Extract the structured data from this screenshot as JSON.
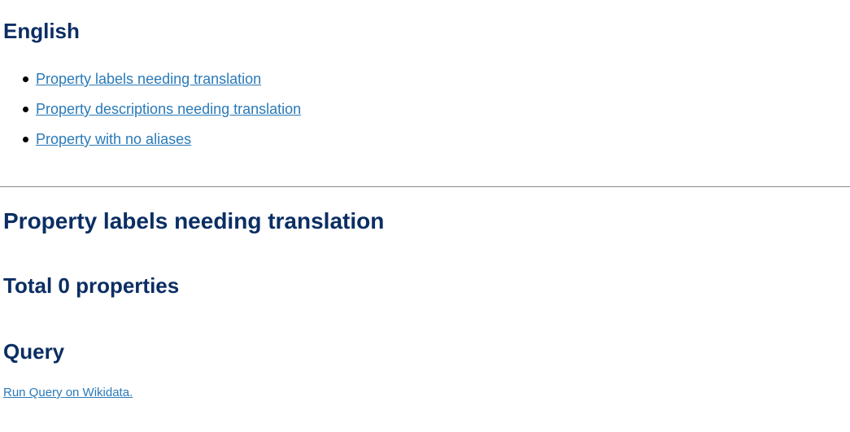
{
  "language_section": {
    "heading": "English",
    "links": [
      {
        "label": "Property labels needing translation"
      },
      {
        "label": "Property descriptions needing translation"
      },
      {
        "label": "Property with no aliases"
      }
    ]
  },
  "results_section": {
    "heading": "Property labels needing translation",
    "total_label": "Total 0 properties"
  },
  "query_section": {
    "heading": "Query",
    "run_link": "Run Query on Wikidata."
  },
  "colors": {
    "heading": "#0b2e63",
    "link": "#2a7ab8",
    "divider": "#8a8a8a"
  }
}
